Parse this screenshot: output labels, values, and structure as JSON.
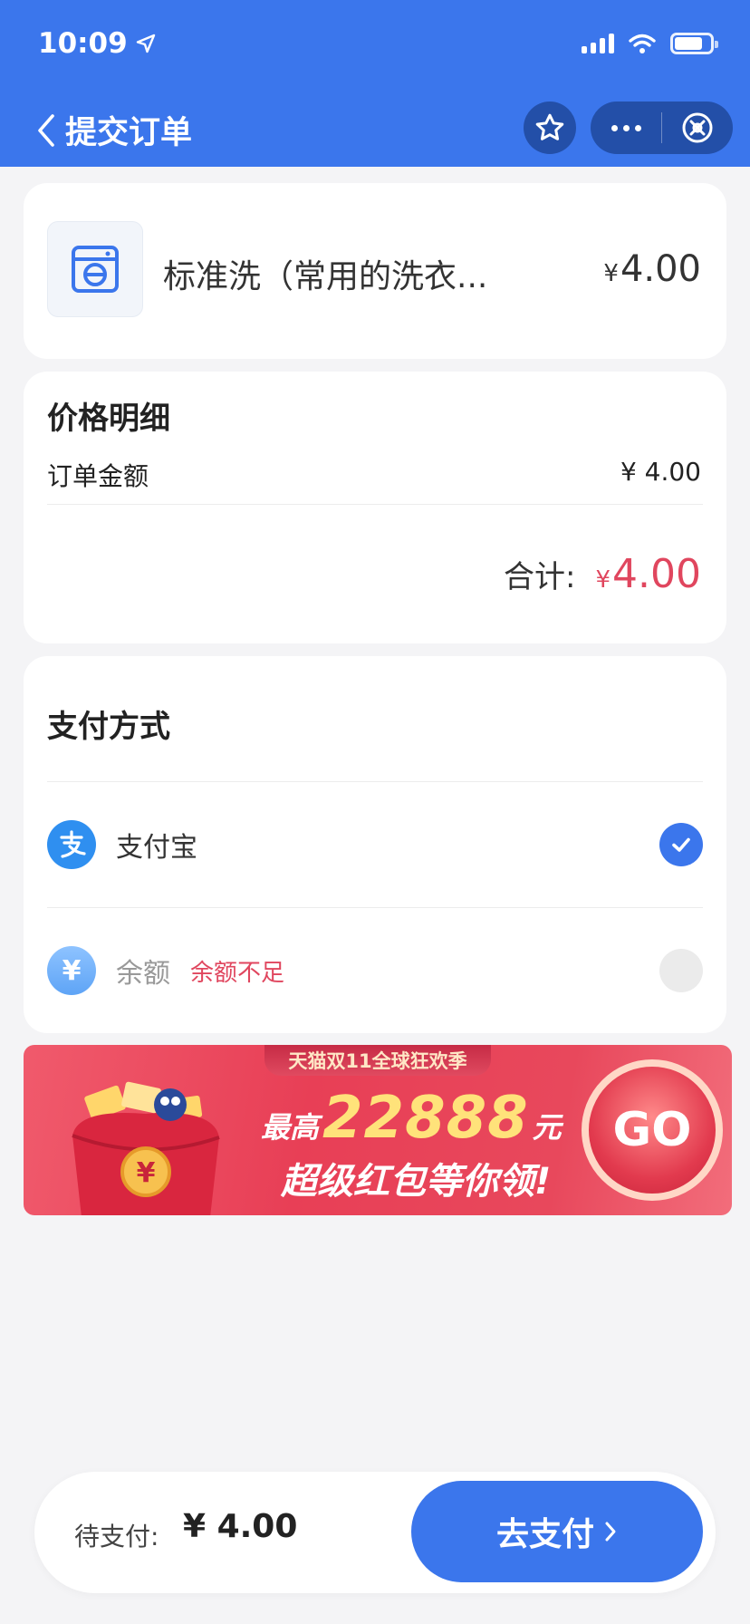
{
  "status_bar": {
    "time": "10:09"
  },
  "nav": {
    "title": "提交订单"
  },
  "product": {
    "name": "标准洗（常用的洗衣...",
    "currency": "¥",
    "price": "4.00"
  },
  "price_detail": {
    "title": "价格明细",
    "order_label": "订单金额",
    "order_amount": "¥ 4.00",
    "total_label": "合计:",
    "total_currency": "¥",
    "total_value": "4.00"
  },
  "payment": {
    "title": "支付方式",
    "methods": [
      {
        "label": "支付宝",
        "icon": "alipay-icon",
        "selected": true
      },
      {
        "label": "余额",
        "icon": "yen-icon",
        "selected": false,
        "warning": "余额不足"
      }
    ]
  },
  "banner": {
    "tag": "天猫双11全球狂欢季",
    "prefix": "最高",
    "amount": "22888",
    "suffix": "元",
    "line2": "超级红包等你领!",
    "go": "GO"
  },
  "bottom": {
    "pending_label": "待支付:",
    "pending_amount": "¥ 4.00",
    "pay_button": "去支付"
  },
  "colors": {
    "primary": "#3b76ec",
    "accent_red": "#e0465e",
    "nav_dark": "#234fa8"
  }
}
